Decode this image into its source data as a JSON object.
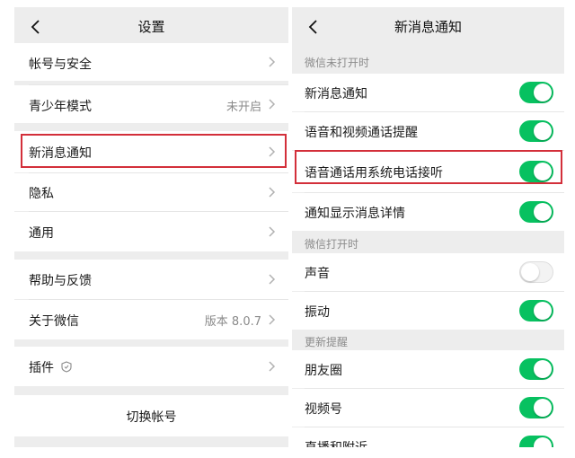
{
  "left": {
    "title": "设置",
    "items": [
      {
        "label": "帐号与安全"
      },
      {
        "label": "青少年模式",
        "value": "未开启"
      },
      {
        "label": "新消息通知"
      },
      {
        "label": "隐私"
      },
      {
        "label": "通用"
      },
      {
        "label": "帮助与反馈"
      },
      {
        "label": "关于微信",
        "value": "版本 8.0.7"
      },
      {
        "label": "插件"
      }
    ],
    "switch_account": "切换帐号"
  },
  "right": {
    "title": "新消息通知",
    "sections": [
      {
        "header": "微信未打开时",
        "items": [
          {
            "label": "新消息通知",
            "enabled": true
          },
          {
            "label": "语音和视频通话提醒",
            "enabled": true
          },
          {
            "label": "语音通话用系统电话接听",
            "enabled": true
          },
          {
            "label": "通知显示消息详情",
            "enabled": true
          }
        ]
      },
      {
        "header": "微信打开时",
        "items": [
          {
            "label": "声音",
            "enabled": false
          },
          {
            "label": "振动",
            "enabled": true
          }
        ]
      },
      {
        "header": "更新提醒",
        "items": [
          {
            "label": "朋友圈",
            "enabled": true
          },
          {
            "label": "视频号",
            "enabled": true
          },
          {
            "label": "直播和附近",
            "enabled": true
          }
        ]
      }
    ]
  },
  "colors": {
    "toggle_on": "#07c160",
    "highlight": "#d32f3a",
    "background": "#ededed"
  },
  "icons": {
    "back": "chevron-left-icon",
    "disclosure": "chevron-right-icon",
    "plugin": "shield-icon"
  }
}
